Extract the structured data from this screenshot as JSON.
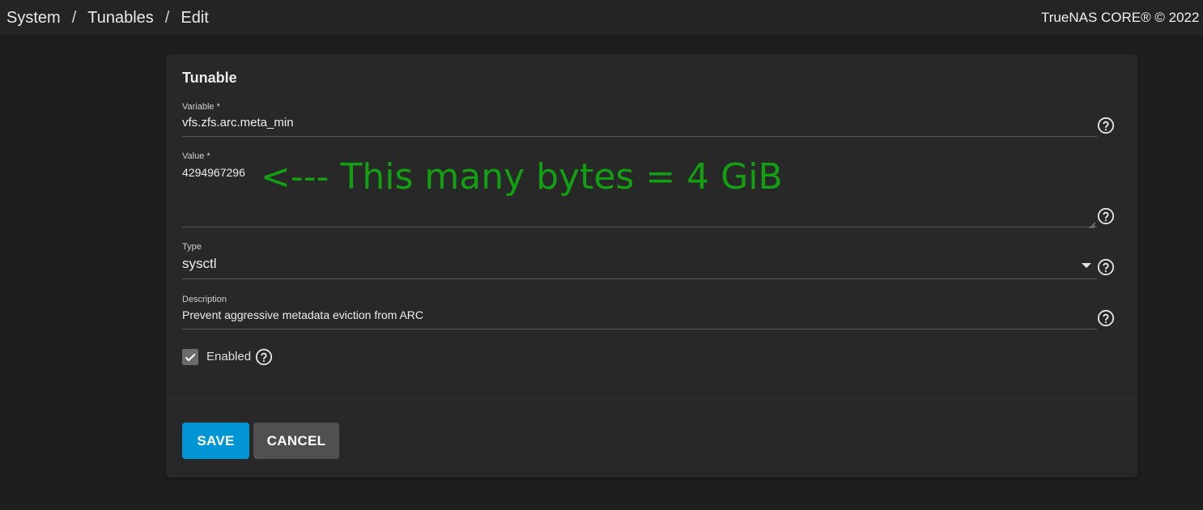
{
  "breadcrumb": {
    "items": [
      "System",
      "Tunables",
      "Edit"
    ],
    "separator": "/"
  },
  "copyright": "TrueNAS CORE® © 2022 -",
  "form": {
    "title": "Tunable",
    "variable": {
      "label": "Variable *",
      "value": "vfs.zfs.arc.meta_min"
    },
    "value": {
      "label": "Value *",
      "value": "4294967296"
    },
    "type": {
      "label": "Type",
      "value": "sysctl"
    },
    "description": {
      "label": "Description",
      "value": "Prevent aggressive metadata eviction from ARC"
    },
    "enabled": {
      "label": "Enabled",
      "checked": true
    }
  },
  "annotation": "<--- This many bytes = 4 GiB",
  "buttons": {
    "save": "SAVE",
    "cancel": "CANCEL"
  },
  "colors": {
    "primary": "#0095d5",
    "annotation": "#12a012",
    "background": "#1e1e1e",
    "card": "#282828"
  },
  "icons": [
    "help-circle-icon",
    "dropdown-caret-icon",
    "checkmark-icon",
    "resize-grip-icon"
  ]
}
